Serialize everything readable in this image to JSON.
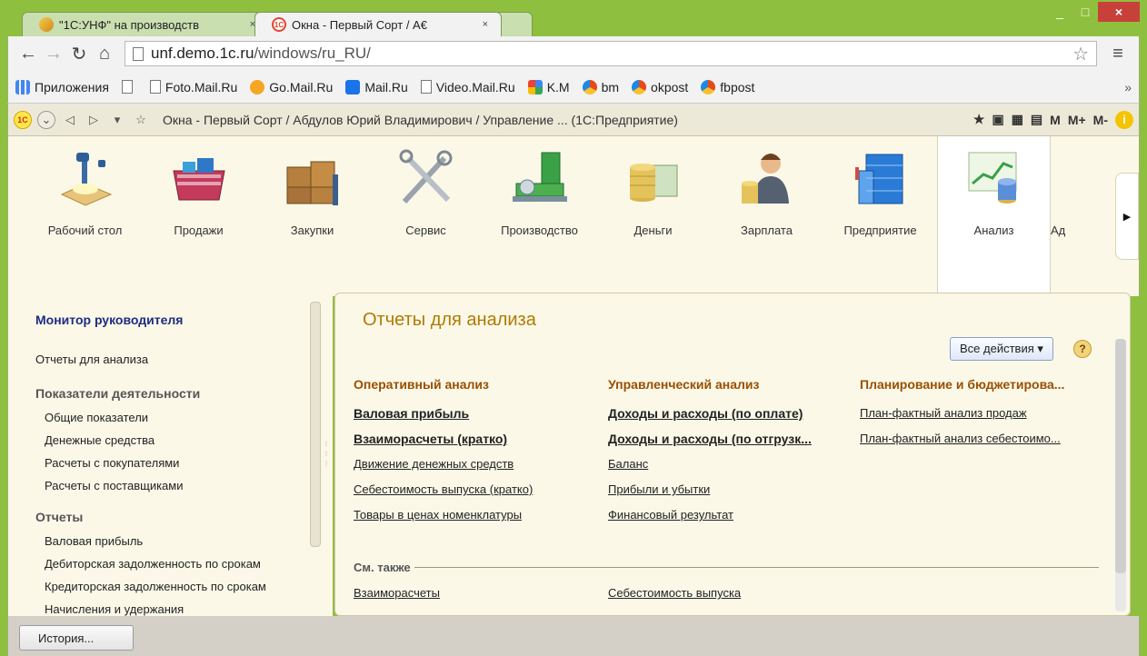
{
  "browser": {
    "tabs": [
      {
        "title": "\"1С:УНФ\" на производств",
        "close": "×"
      },
      {
        "title": "Окна - Первый Сорт / А€",
        "close": "×"
      }
    ],
    "window_controls": {
      "minimize": "_",
      "maximize": "□",
      "close": "×"
    },
    "url_host": "unf.demo.1c.ru",
    "url_path": "/windows/ru_RU/",
    "bookmarks": [
      {
        "label": "Приложения",
        "icon": "apps-icon"
      },
      {
        "label": "",
        "icon": "page-icon"
      },
      {
        "label": "Foto.Mail.Ru",
        "icon": "page-icon"
      },
      {
        "label": "Go.Mail.Ru",
        "icon": "go-icon"
      },
      {
        "label": "Mail.Ru",
        "icon": "mail-icon"
      },
      {
        "label": "Video.Mail.Ru",
        "icon": "page-icon"
      },
      {
        "label": "K.M",
        "icon": "km-icon"
      },
      {
        "label": "bm",
        "icon": "ok-icon"
      },
      {
        "label": "okpost",
        "icon": "ok-icon"
      },
      {
        "label": "fbpost",
        "icon": "ok-icon"
      }
    ],
    "bookmarks_more": "»"
  },
  "toolbar": {
    "title": "Окна - Первый Сорт / Абдулов Юрий Владимирович / Управление ... (1С:Предприятие)",
    "mem_buttons": [
      "M",
      "M+",
      "M-"
    ],
    "info": "i"
  },
  "sections": [
    {
      "label": "Рабочий стол",
      "icon": "desk-lamp-icon"
    },
    {
      "label": "Продажи",
      "icon": "basket-icon"
    },
    {
      "label": "Закупки",
      "icon": "boxes-icon"
    },
    {
      "label": "Сервис",
      "icon": "tools-icon"
    },
    {
      "label": "Производство",
      "icon": "machine-icon"
    },
    {
      "label": "Деньги",
      "icon": "money-icon"
    },
    {
      "label": "Зарплата",
      "icon": "employee-icon"
    },
    {
      "label": "Предприятие",
      "icon": "building-icon"
    },
    {
      "label": "Анализ",
      "icon": "chart-icon",
      "active": true
    },
    {
      "label": "Ад",
      "icon": ""
    }
  ],
  "left_panel": {
    "header": "Монитор руководителя",
    "link": "Отчеты для анализа",
    "groups": [
      {
        "title": "Показатели деятельности",
        "items": [
          "Общие показатели",
          "Денежные средства",
          "Расчеты с покупателями",
          "Расчеты с поставщиками"
        ]
      },
      {
        "title": "Отчеты",
        "items": [
          "Валовая прибыль",
          "Дебиторская задолженность по срокам",
          "Кредиторская задолженность по срокам",
          "Начисления и удержания"
        ]
      }
    ]
  },
  "main": {
    "title": "Отчеты для анализа",
    "all_actions": "Все действия ▾",
    "help": "?",
    "columns": [
      {
        "title": "Оперативный анализ",
        "items": [
          {
            "label": "Валовая прибыль",
            "bold": true
          },
          {
            "label": "Взаиморасчеты (кратко)",
            "bold": true
          },
          {
            "label": "Движение денежных средств",
            "bold": false
          },
          {
            "label": "Себестоимость выпуска (кратко)",
            "bold": false
          },
          {
            "label": "Товары в ценах номенклатуры",
            "bold": false
          }
        ]
      },
      {
        "title": "Управленческий анализ",
        "items": [
          {
            "label": "Доходы и расходы (по оплате)",
            "bold": true
          },
          {
            "label": "Доходы и расходы (по отгрузк...",
            "bold": true
          },
          {
            "label": "Баланс",
            "bold": false
          },
          {
            "label": "Прибыли и убытки",
            "bold": false
          },
          {
            "label": "Финансовый результат",
            "bold": false
          }
        ]
      },
      {
        "title": "Планирование и бюджетирова...",
        "items": [
          {
            "label": "План-фактный анализ продаж",
            "bold": false
          },
          {
            "label": "План-фактный анализ себестоимо...",
            "bold": false
          }
        ]
      }
    ],
    "see_also_label": "См. также",
    "see_also": [
      "Взаиморасчеты",
      "Себестоимость выпуска"
    ]
  },
  "bottom": {
    "history_button": "История..."
  }
}
